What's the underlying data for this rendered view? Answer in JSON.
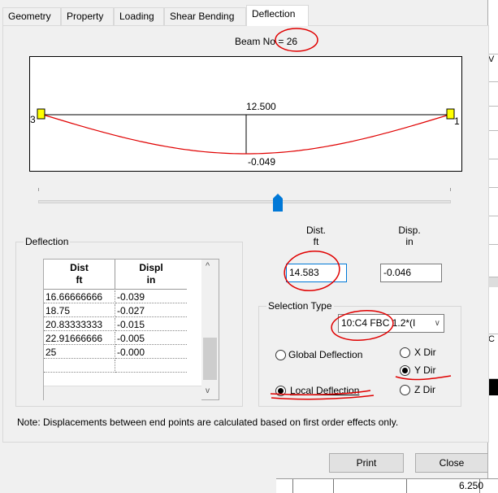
{
  "tabs": [
    {
      "label": "Geometry"
    },
    {
      "label": "Property"
    },
    {
      "label": "Loading"
    },
    {
      "label": "Shear Bending"
    },
    {
      "label": "Deflection"
    }
  ],
  "beam": {
    "title": "Beam No = 26",
    "start_node": "3",
    "end_node": "1",
    "top_value": "12.500",
    "bottom_value": "-0.049"
  },
  "deflection_group": {
    "label": "Deflection",
    "columns": [
      {
        "name": "Dist",
        "unit": "ft"
      },
      {
        "name": "Displ",
        "unit": "in"
      }
    ],
    "rows": [
      {
        "dist": "16.66666666",
        "displ": "-0.039"
      },
      {
        "dist": "18.75",
        "displ": "-0.027"
      },
      {
        "dist": "20.83333333",
        "displ": "-0.015"
      },
      {
        "dist": "22.91666666",
        "displ": "-0.005"
      },
      {
        "dist": "25",
        "displ": "-0.000"
      }
    ]
  },
  "dist_field": {
    "label": "Dist.",
    "unit": "ft",
    "value": "14.583"
  },
  "disp_field": {
    "label": "Disp.",
    "unit": "in",
    "value": "-0.046"
  },
  "selection": {
    "label": "Selection Type",
    "combo_value": "10:C4 FBC 1.2*(I",
    "global_label": "Global Deflection",
    "local_label": "Local Deflection",
    "x_dir": "X Dir",
    "y_dir": "Y Dir",
    "z_dir": "Z Dir",
    "selected_type": "Local Deflection",
    "selected_dir": "Y Dir"
  },
  "note": "Note: Displacements between end points are calculated based on first order effects only.",
  "buttons": {
    "print": "Print",
    "close": "Close"
  },
  "background": {
    "cell_value": "6.250"
  },
  "slider": {
    "position_fraction": 0.58
  },
  "colors": {
    "curve": "#e00000",
    "annotation": "#e00000",
    "support": "#ffff00",
    "thumb": "#0078d7"
  }
}
